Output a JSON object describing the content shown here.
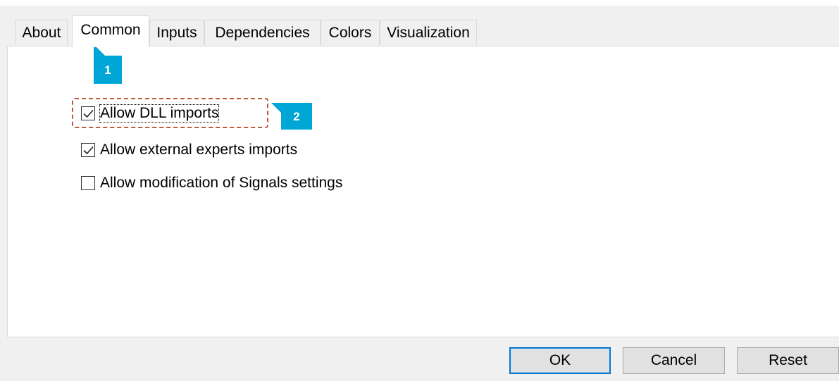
{
  "tabs": [
    {
      "label": "About",
      "active": false
    },
    {
      "label": "Common",
      "active": true
    },
    {
      "label": "Inputs",
      "active": false
    },
    {
      "label": "Dependencies",
      "active": false
    },
    {
      "label": "Colors",
      "active": false
    },
    {
      "label": "Visualization",
      "active": false
    }
  ],
  "callouts": {
    "tab_marker": "1",
    "dll_marker": "2"
  },
  "options": [
    {
      "label": "Allow DLL imports",
      "checked": true,
      "focused": true
    },
    {
      "label": "Allow external experts imports",
      "checked": true,
      "focused": false
    },
    {
      "label": "Allow modification of Signals settings",
      "checked": false,
      "focused": false
    }
  ],
  "buttons": {
    "ok": "OK",
    "cancel": "Cancel",
    "reset": "Reset"
  },
  "colors": {
    "callout": "#00a7d6",
    "highlight": "#c0583a",
    "default_button_border": "#0078d7"
  }
}
